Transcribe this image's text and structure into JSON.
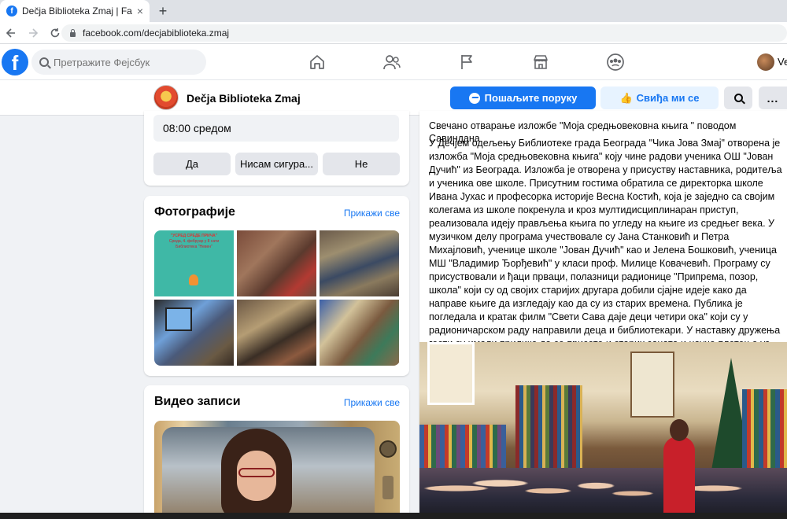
{
  "browser": {
    "tab_title": "Dečja Biblioteka Zmaj | Facebook",
    "tab_close": "×",
    "new_tab": "+",
    "url": "facebook.com/decjabiblioteka.zmaj"
  },
  "fb_header": {
    "logo": "f",
    "search_placeholder": "Претражите Фејсбук",
    "user_short": "Ve"
  },
  "page_header": {
    "name": "Dečja Biblioteka Zmaj",
    "message_button": "Пошаљите поруку",
    "like_button": "Свиђа ми се",
    "more_button": "..."
  },
  "event": {
    "time": "08:00 средом",
    "rsvp_yes": "Да",
    "rsvp_maybe": "Нисам сигура...",
    "rsvp_no": "Не"
  },
  "photos": {
    "title": "Фотографије",
    "see_all": "Прикажи све",
    "poster_line1": "\"УСРЕД СРЕДЕ ПРИЧА\"",
    "poster_line2": "Среда, 4. фебруар у 8 сати",
    "poster_line3": "Библиотека \"Невен\""
  },
  "videos": {
    "title": "Видео записи",
    "see_all": "Прикажи све"
  },
  "post": {
    "title": "Свечано отварање изложбе \"Моја средњовековна књига \" поводом Савиндана",
    "body": "У Дечјем одељењу Библиотеке града Београда \"Чика Јова Змај\" отворена је изложба \"Моја средњовековна књига\" коју чине радови ученика ОШ \"Јован Дучић\" из Београда. Изложба је отворена у присуству наставника, родитеља и ученика ове школе. Присутним гостима обратила се директорка школе Ивана Јухас и професорка историје Весна Костић, која је заједно са својим колегама из школе покренула и кроз мултидисциплинаран приступ, реализовала идеју прављења књига по угледу на књиге из средњег века. У музичком делу програма учествовале су Јана Станковић и Петра Михајловић, ученице школе \"Јован Дучић\" као и Јелена Бошковић, ученица МШ \"Владимир Ђорђевић\" у класи проф. Милице Ковачевић. Програму су присуствовали и ђаци прваци, полазници радионице \"Припрема, позор, школа\" који су од својих старијих другара добили сјајне идеје како да направе књиге да изгледају као да су из старих времена. Публика је погледала  и кратак филм \"Свети Сава даје деци четири ока\" који су у радионичарском раду направили деца и библиотекари.  У наставку дружења гости су имали прилике да се присете и старих заната и науче плетење уз помоћ прстију."
  },
  "colors": {
    "brand_blue": "#1877f2",
    "page_bg": "#f0f2f5",
    "light_blue": "#e7f3ff"
  },
  "icons": {
    "nav": [
      "home-icon",
      "friends-icon",
      "pages-flag-icon",
      "marketplace-icon",
      "groups-icon"
    ]
  }
}
